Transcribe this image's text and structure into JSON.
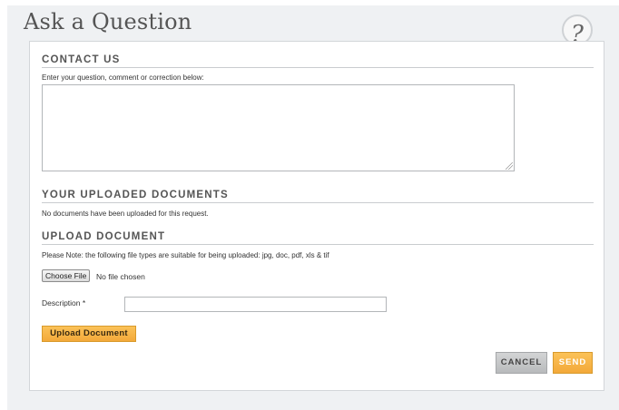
{
  "page": {
    "title": "Ask a Question",
    "help_glyph": "?"
  },
  "contact": {
    "heading": "CONTACT US",
    "instruction": "Enter your question, comment or correction below:",
    "question_value": ""
  },
  "uploaded": {
    "heading": "YOUR UPLOADED DOCUMENTS",
    "empty_text": "No documents have been uploaded for this request."
  },
  "upload": {
    "heading": "UPLOAD DOCUMENT",
    "note": "Please Note: the following file types are suitable for being uploaded: jpg, doc, pdf, xls & tif",
    "choose_file_label": "Choose File",
    "no_file_text": "No file chosen",
    "description_label": "Description *",
    "description_value": "",
    "upload_button_label": "Upload Document"
  },
  "actions": {
    "cancel_label": "CANCEL",
    "send_label": "SEND"
  },
  "colors": {
    "accent": "#f3a93a",
    "panel_bg": "#eff1f3",
    "cancel_bg": "#c4c6c8"
  },
  "icons": {
    "help": "question-mark-icon",
    "resize": "resize-grip-icon"
  }
}
